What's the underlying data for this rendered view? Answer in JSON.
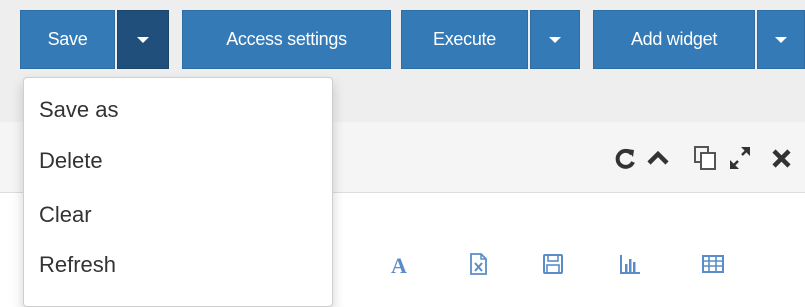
{
  "toolbar": {
    "save_label": "Save",
    "access_label": "Access settings",
    "execute_label": "Execute",
    "add_widget_label": "Add widget"
  },
  "save_menu": {
    "items": [
      "Save as",
      "Delete",
      "Clear",
      "Refresh"
    ]
  },
  "panel_header": {
    "icons": [
      "refresh-icon",
      "collapse-icon",
      "copy-icon",
      "expand-icon",
      "close-icon"
    ]
  },
  "widget_toolbar": {
    "icons": [
      "font-icon",
      "excel-icon",
      "save-icon",
      "chart-icon",
      "table-icon"
    ]
  },
  "colors": {
    "primary": "#337ab7",
    "primary_dark": "#1f4f7a",
    "icon_blue": "#5a8dc7",
    "header_icon": "#333333"
  }
}
